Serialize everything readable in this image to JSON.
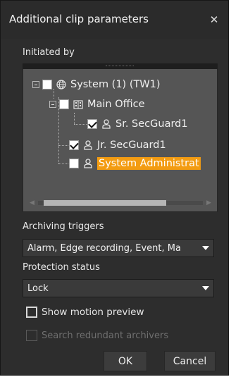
{
  "dialog": {
    "title": "Additional clip parameters",
    "close_glyph": "✕"
  },
  "initiated_by": {
    "label": "Initiated by",
    "tree": [
      {
        "text": "System (1) (TW1)",
        "icon": "globe-icon",
        "checked": false,
        "expander": "collapse"
      },
      {
        "text": "Main Office",
        "icon": "building-icon",
        "checked": false,
        "expander": "collapse"
      },
      {
        "text": "Sr. SecGuard1",
        "icon": "user-icon",
        "checked": true
      },
      {
        "text": "Jr. SecGuard1",
        "icon": "user-icon",
        "checked": true
      },
      {
        "text": "System Administrat",
        "icon": "user-icon",
        "checked": false,
        "selected": true
      }
    ],
    "selection_color": "#f39c12"
  },
  "archiving_triggers": {
    "label": "Archiving triggers",
    "value": "Alarm, Edge recording, Event, Ma"
  },
  "protection_status": {
    "label": "Protection status",
    "value": "Lock"
  },
  "options": {
    "show_motion_preview": "Show motion preview",
    "search_redundant": "Search redundant archivers"
  },
  "buttons": {
    "ok": "OK",
    "cancel": "Cancel"
  }
}
